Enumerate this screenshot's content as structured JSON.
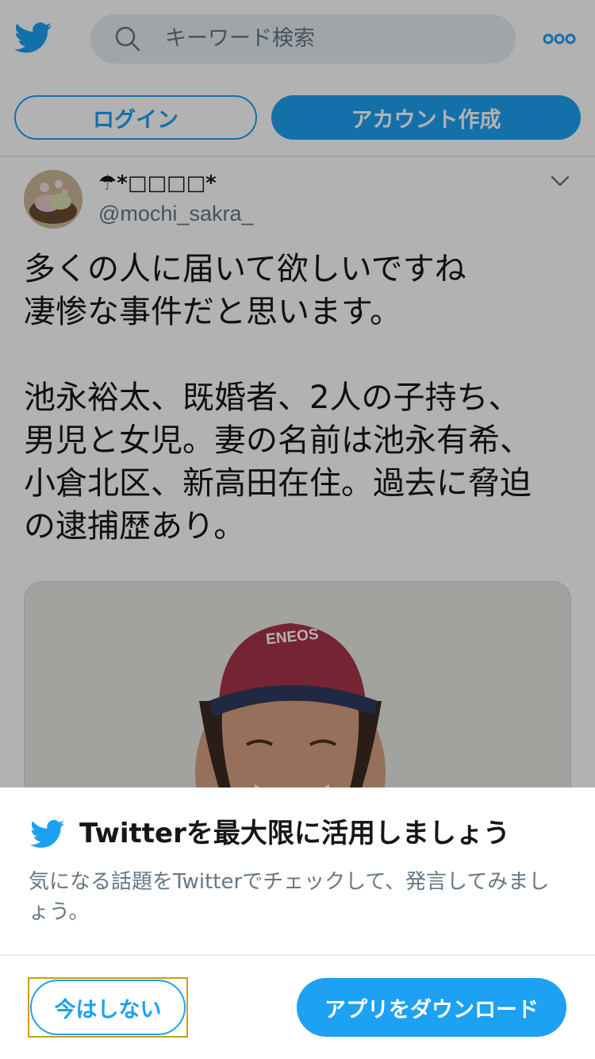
{
  "colors": {
    "brand": "#1da1f2",
    "text_primary": "#14171a",
    "text_secondary": "#657786",
    "search_bg": "#e6ecf0"
  },
  "header": {
    "logo_icon": "twitter-bird-icon",
    "search": {
      "placeholder": "キーワード検索",
      "icon": "search-icon"
    },
    "more_icon": "more-dots-icon",
    "login_label": "ログイン",
    "signup_label": "アカウント作成"
  },
  "tweet": {
    "author": {
      "display_name": "☂*□□□□*",
      "handle": "@mochi_sakra_"
    },
    "menu_icon": "chevron-down-icon",
    "text_lines": [
      "多くの人に届いて欲しいですね",
      "凄惨な事件だと思います。",
      "",
      "池永裕太、既婚者、2人の子持ち、",
      "男児と女児。妻の名前は池永有希、",
      "小倉北区、新高田在住。過去に脅迫",
      "の逮捕歴あり。"
    ],
    "photo": {
      "cap_text": "ENEOS"
    }
  },
  "sheet": {
    "icon": "twitter-bird-icon",
    "title": "Twitterを最大限に活用しましょう",
    "description": "気になる話題をTwitterでチェックして、発言してみましょう。",
    "not_now_label": "今はしない",
    "download_label": "アプリをダウンロード"
  }
}
